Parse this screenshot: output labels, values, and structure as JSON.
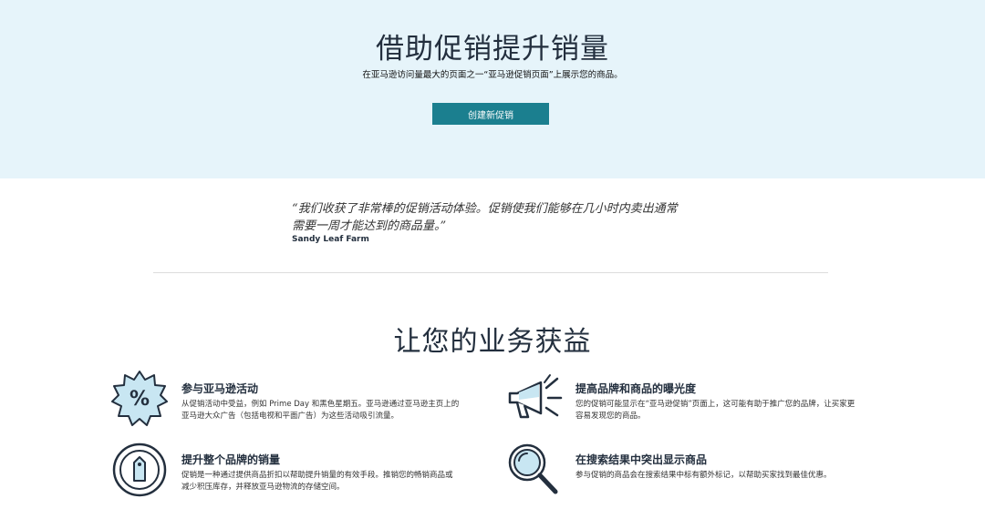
{
  "hero": {
    "title": "借助促销提升销量",
    "subtitle": "在亚马逊访问量最大的页面之一“亚马逊促销页面”上展示您的商品。",
    "cta_label": "创建新促销"
  },
  "testimonial": {
    "quote_line1": "“我们收获了非常棒的促销活动体验。促销使我们能够在几小时内卖出通常",
    "quote_line2": "需要一周才能达到的商品量。”",
    "author": "Sandy Leaf Farm"
  },
  "benefits": {
    "title": "让您的业务获益",
    "items": [
      {
        "icon": "percent-badge-icon",
        "title": "参与亚马逊活动",
        "desc_line1": "从促销活动中受益，例如 Prime Day 和黑色星期五。亚马逊通过亚马逊主页上的",
        "desc_line2": "亚马逊大众广告（包括电视和平面广告）为这些活动吸引流量。"
      },
      {
        "icon": "megaphone-icon",
        "title": "提高品牌和商品的曝光度",
        "desc_line1": "您的促销可能显示在“亚马逊促销”页面上，这可能有助于推广您的品牌，让买家更",
        "desc_line2": "容易发现您的商品。"
      },
      {
        "icon": "price-tag-icon",
        "title": "提升整个品牌的销量",
        "desc_line1": "促销是一种通过提供商品折扣以帮助提升销量的有效手段。推销您的畅销商品或",
        "desc_line2": "减少积压库存，并释放亚马逊物流的存储空间。"
      },
      {
        "icon": "magnifier-icon",
        "title": "在搜索结果中突出显示商品",
        "desc_line1": "参与促销的商品会在搜索结果中标有额外标记，以帮助买家找到最佳优惠。",
        "desc_line2": ""
      }
    ]
  },
  "colors": {
    "hero_bg": "#e6f4fa",
    "cta_bg": "#1b7f8f",
    "icon_fill": "#c8e6f2",
    "ink": "#232f3e"
  }
}
